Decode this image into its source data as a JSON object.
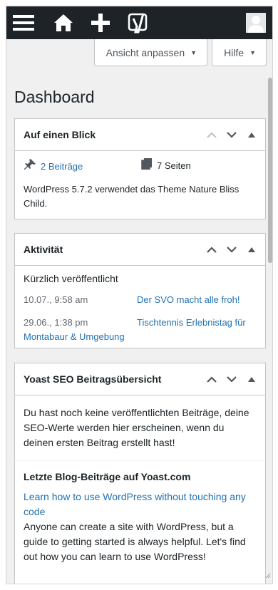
{
  "adminbar": {
    "icons": [
      "menu-icon",
      "home-icon",
      "plus-icon",
      "yoast-icon",
      "avatar-icon"
    ]
  },
  "screen_options": {
    "view_label": "Ansicht anpassen",
    "help_label": "Hilfe"
  },
  "page": {
    "title": "Dashboard"
  },
  "glance": {
    "title": "Auf einen Blick",
    "posts": "2 Beiträge",
    "pages": "7 Seiten",
    "version_text": "WordPress 5.7.2 verwendet das Theme Nature Bliss Child."
  },
  "activity": {
    "title": "Aktivität",
    "heading": "Kürzlich veröffentlicht",
    "items": [
      {
        "date": "10.07., 9:58 am",
        "title": "Der SVO macht alle froh!"
      },
      {
        "date": "29.06., 1:38 pm",
        "title": "Tischtennis Erlebnistag für Montabaur & Umgebung"
      }
    ]
  },
  "yoast": {
    "title": "Yoast SEO Beitragsübersicht",
    "notice": "Du hast noch keine veröffentlichten Beiträge, deine SEO-Werte werden hier erscheinen, wenn du deinen ersten Beitrag erstellt hast!",
    "blog_title": "Letzte Blog-Beiträge auf Yoast.com",
    "blog_link": "Learn how to use WordPress without touching any code",
    "blog_text": "Anyone can create a site with WordPress, but a guide to getting started is always helpful. Let's find out how you can learn to use WordPress!"
  },
  "colors": {
    "adminbar": "#1d2327",
    "link": "#2271b1",
    "background": "#f0f0f1"
  }
}
